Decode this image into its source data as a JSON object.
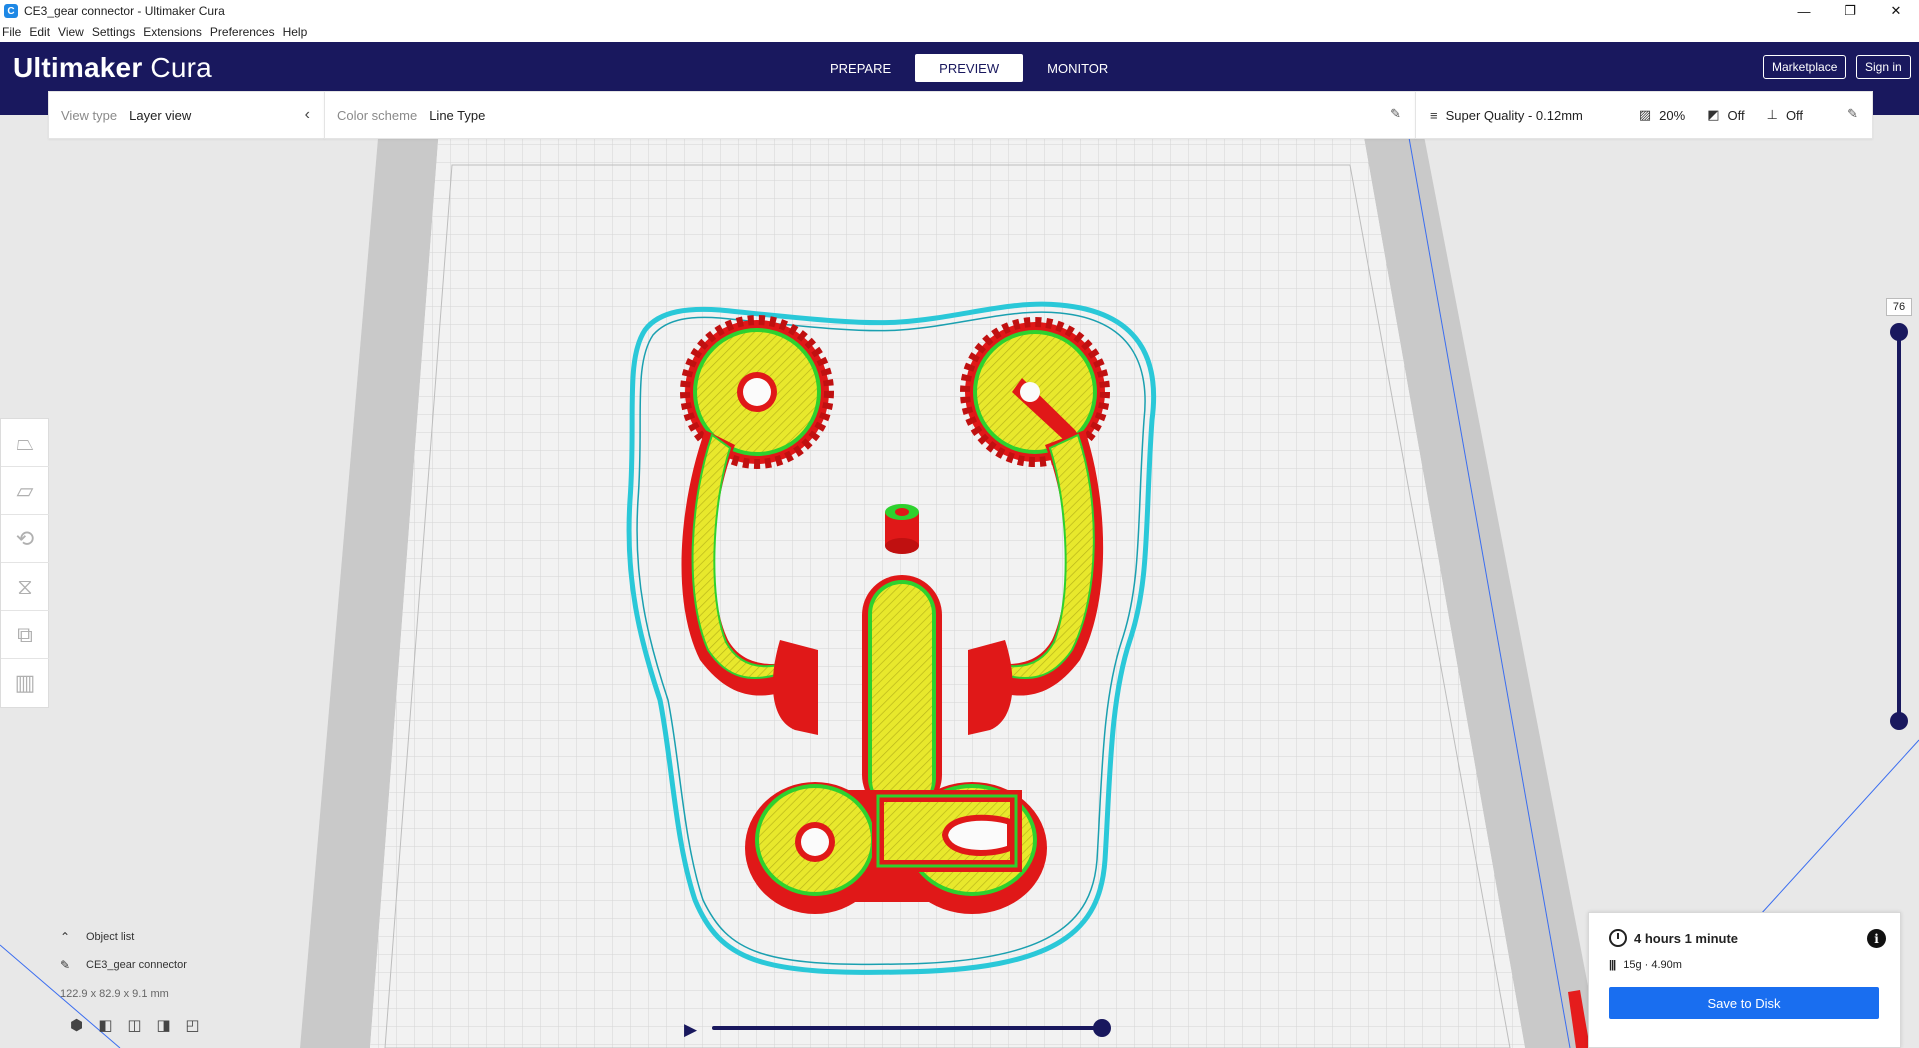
{
  "window": {
    "title": "CE3_gear connector - Ultimaker Cura",
    "app_icon_letter": "C",
    "minimize": "—",
    "restore": "❐",
    "close": "✕"
  },
  "menu": [
    "File",
    "Edit",
    "View",
    "Settings",
    "Extensions",
    "Preferences",
    "Help"
  ],
  "header": {
    "brand": "Ultimaker",
    "product": "Cura",
    "tabs": [
      {
        "label": "PREPARE",
        "active": false
      },
      {
        "label": "PREVIEW",
        "active": true
      },
      {
        "label": "MONITOR",
        "active": false
      }
    ],
    "marketplace": "Marketplace",
    "signin": "Sign in"
  },
  "view_bar": {
    "view_type_label": "View type",
    "view_type_value": "Layer view",
    "color_scheme_label": "Color scheme",
    "color_scheme_value": "Line Type"
  },
  "print_setup": {
    "profile": "Super Quality - 0.12mm",
    "infill": "20%",
    "support": "Off",
    "adhesion": "Off"
  },
  "layer_slider": {
    "current_layer": "76",
    "top_fraction": 1.0
  },
  "object_list": {
    "title": "Object list",
    "object_name": "CE3_gear connector",
    "dimensions": "122.9 x 82.9 x 9.1 mm"
  },
  "simulation": {
    "progress": 1.0
  },
  "print_info": {
    "time": "4 hours 1 minute",
    "material": "15g · 4.90m",
    "save_label": "Save to Disk"
  },
  "colors": {
    "header": "#19185e",
    "accent": "#196ef0",
    "wall_outer": "#e81a1a",
    "wall_inner": "#2ed12e",
    "infill": "#e6e62a",
    "skirt": "#2ac8d8",
    "bed": "#f0f0f0"
  }
}
